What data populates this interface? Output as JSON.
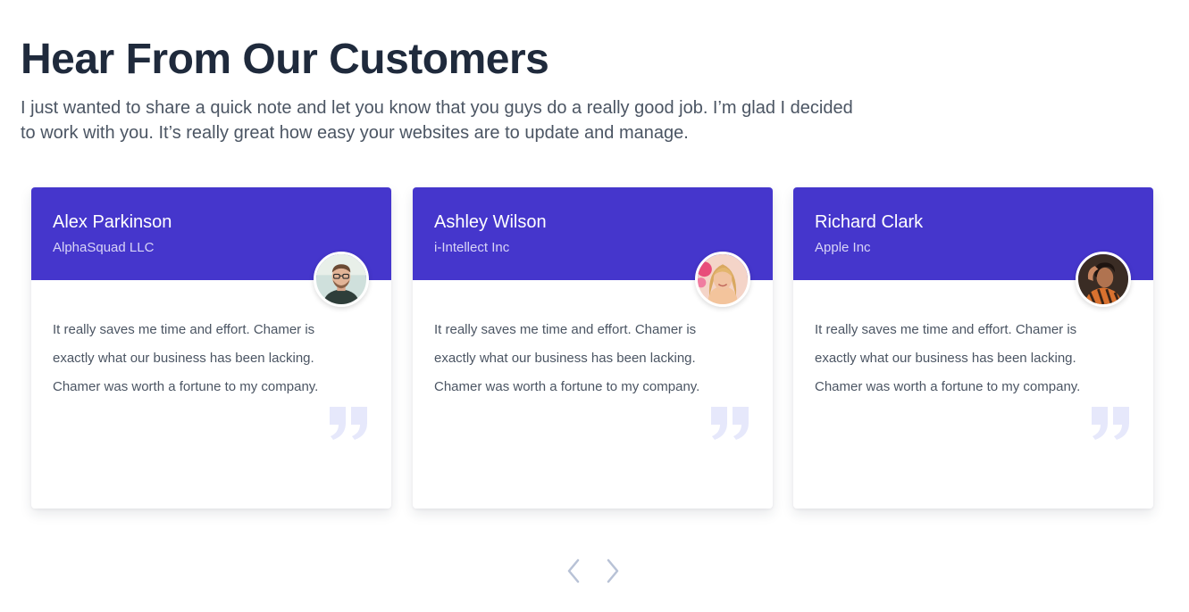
{
  "header": {
    "title": "Hear From Our Customers",
    "subtitle": "I just wanted to share a quick note and let you know that you guys do a really good job. I’m glad I decided to work with you. It’s really great how easy your websites are to update and manage."
  },
  "testimonials": [
    {
      "name": "Alex Parkinson",
      "company": "AlphaSquad LLC",
      "text": "It really saves me time and effort. Chamer is exactly what our business has been lacking. Chamer was worth a fortune to my company.",
      "avatar_icon": "avatar-man-glasses"
    },
    {
      "name": "Ashley Wilson",
      "company": "i-Intellect Inc",
      "text": "It really saves me time and effort. Chamer is exactly what our business has been lacking. Chamer was worth a fortune to my company.",
      "avatar_icon": "avatar-woman-blonde"
    },
    {
      "name": "Richard Clark",
      "company": "Apple Inc",
      "text": "It really saves me time and effort. Chamer is exactly what our business has been lacking. Chamer was worth a fortune to my company.",
      "avatar_icon": "avatar-person-hand-on-head"
    }
  ],
  "navigation": {
    "prev_icon": "chevron-left-icon",
    "next_icon": "chevron-right-icon"
  },
  "colors": {
    "card_header": "#4536cc",
    "title": "#1f2a3c",
    "body_text": "#4b5563",
    "quote_mark": "#e6e8fb",
    "nav_arrow": "#b8c2d6"
  }
}
